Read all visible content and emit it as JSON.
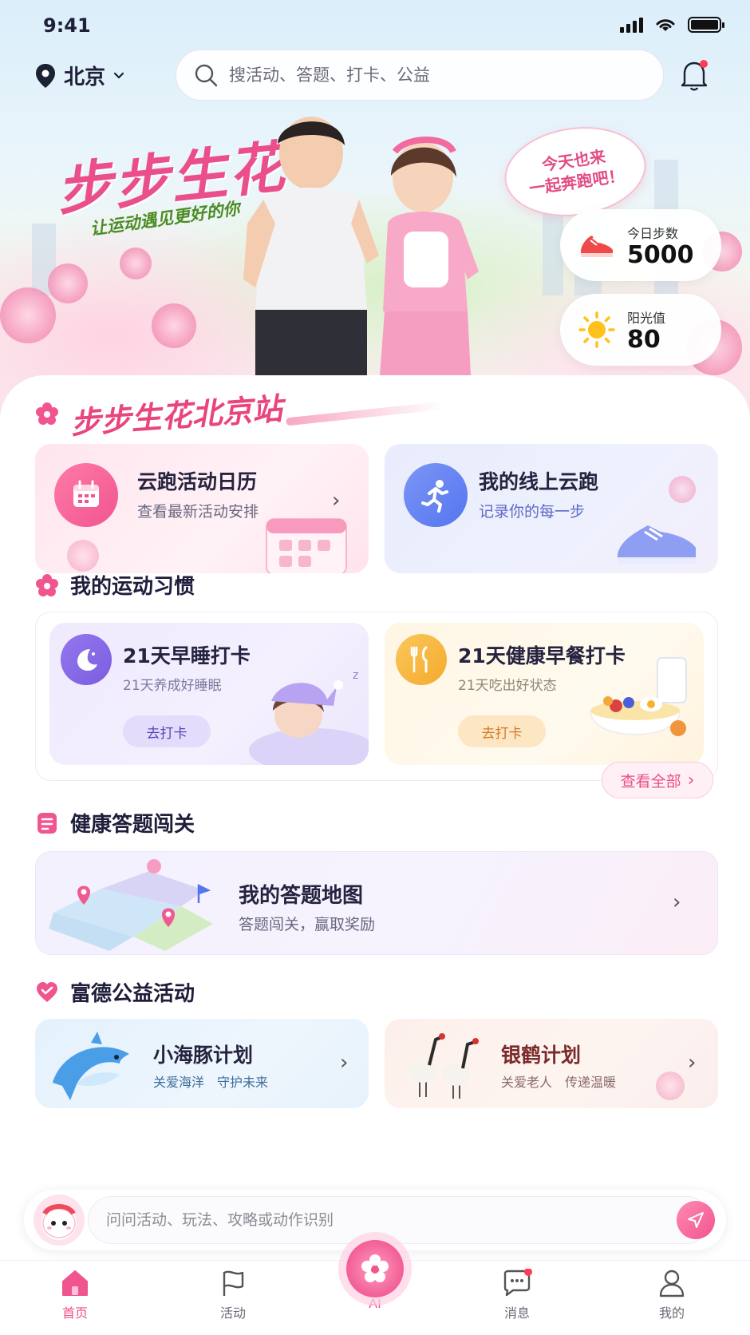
{
  "status": {
    "time": "9:41"
  },
  "header": {
    "location": "北京",
    "search_placeholder": "搜活动、答题、打卡、公益"
  },
  "hero": {
    "title": "步步生花",
    "subtitle": "让运动遇见更好的你",
    "bubble_line1": "今天也来",
    "bubble_line2": "一起奔跑吧！",
    "steps_label": "今日步数",
    "steps_value": "5000",
    "sun_label": "阳光值",
    "sun_value": "80"
  },
  "station": {
    "title": "步步生花北京站"
  },
  "run_cards": [
    {
      "title": "云跑活动日历",
      "subtitle": "查看最新活动安排"
    },
    {
      "title": "我的线上云跑",
      "subtitle": "记录你的每一步"
    }
  ],
  "habits": {
    "section_title": "我的运动习惯",
    "items": [
      {
        "title": "21天早睡打卡",
        "subtitle": "21天养成好睡眠",
        "button": "去打卡"
      },
      {
        "title": "21天健康早餐打卡",
        "subtitle": "21天吃出好状态",
        "button": "去打卡"
      }
    ],
    "view_all": "查看全部"
  },
  "quiz": {
    "section_title": "健康答题闯关",
    "card_title": "我的答题地图",
    "card_subtitle": "答题闯关，赢取奖励"
  },
  "charity": {
    "section_title": "富德公益活动",
    "items": [
      {
        "title": "小海豚计划",
        "subtitle": "关爱海洋　守护未来"
      },
      {
        "title": "银鹤计划",
        "subtitle": "关爱老人　传递温暖"
      }
    ]
  },
  "ai_bar": {
    "placeholder": "问问活动、玩法、攻略或动作识别"
  },
  "tabs": [
    {
      "label": "首页"
    },
    {
      "label": "活动"
    },
    {
      "label": "AI"
    },
    {
      "label": "消息"
    },
    {
      "label": "我的"
    }
  ],
  "colors": {
    "accent": "#ef4f8a",
    "purple": "#7b5ee0",
    "blue": "#5b7ef0",
    "orange": "#f6b53e"
  }
}
